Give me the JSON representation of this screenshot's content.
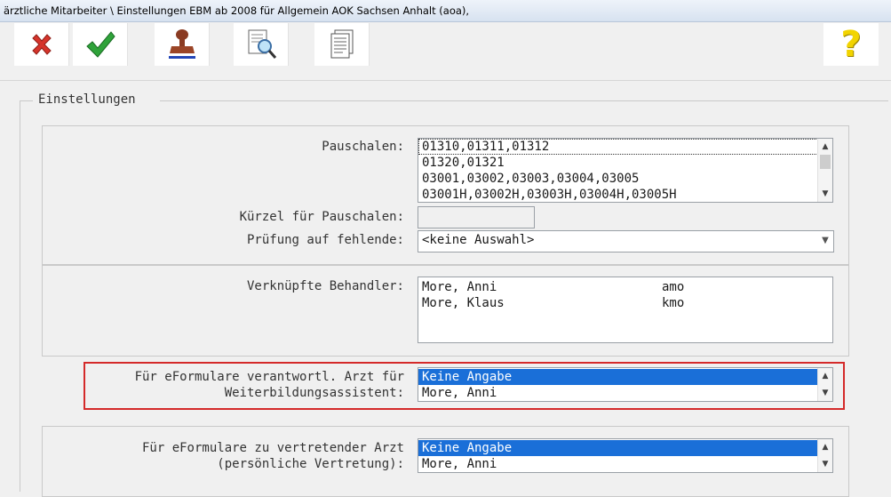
{
  "window": {
    "title": "ärztliche Mitarbeiter \\ Einstellungen EBM ab 2008 für Allgemein AOK Sachsen Anhalt (aoa),"
  },
  "toolbar": {
    "buttons": [
      {
        "icon": "close-icon"
      },
      {
        "icon": "checkmark-icon"
      },
      {
        "icon": "stamp-icon"
      },
      {
        "icon": "document-search-icon"
      },
      {
        "icon": "pages-icon"
      },
      {
        "icon": "help-icon",
        "symbol": "?"
      }
    ]
  },
  "settings": {
    "legend": "Einstellungen",
    "pauschalen": {
      "label": "Pauschalen:",
      "items": [
        "01310,01311,01312",
        "01320,01321",
        "03001,03002,03003,03004,03005",
        "03001H,03002H,03003H,03004H,03005H"
      ]
    },
    "kuerzel": {
      "label": "Kürzel für Pauschalen:",
      "value": ""
    },
    "pruefung": {
      "label": "Prüfung auf fehlende:",
      "value": "<keine Auswahl>"
    },
    "behandler": {
      "label": "Verknüpfte Behandler:",
      "rows": [
        {
          "name": "More, Anni",
          "code": "amo"
        },
        {
          "name": "More, Klaus",
          "code": "kmo"
        }
      ]
    },
    "weiterbildung": {
      "label_line1": "Für eFormulare verantwortl. Arzt für",
      "label_line2": "Weiterbildungsassistent:",
      "options": [
        "Keine Angabe",
        "More, Anni"
      ],
      "selected": "Keine Angabe"
    },
    "vertretung": {
      "label_line1": "Für eFormulare zu vertretender Arzt",
      "label_line2": "(persönliche Vertretung):",
      "options": [
        "Keine Angabe",
        "More, Anni"
      ],
      "selected": "Keine Angabe"
    }
  },
  "colors": {
    "selection": "#1a6fd8",
    "highlight_frame": "#d42a2a"
  }
}
